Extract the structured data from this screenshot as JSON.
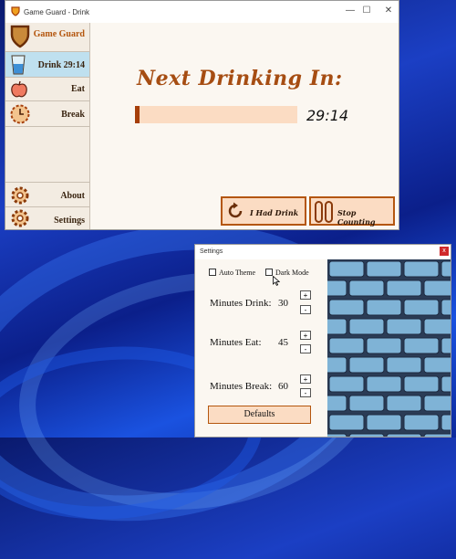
{
  "window": {
    "title": "Game Guard - Drink",
    "min_glyph": "—",
    "max_glyph": "☐",
    "close_glyph": "✕"
  },
  "sidebar": {
    "brand": "Game Guard",
    "items": [
      {
        "label": "Drink 29:14",
        "icon": "glass-icon"
      },
      {
        "label": "Eat",
        "icon": "apple-icon"
      },
      {
        "label": "Break",
        "icon": "clock-icon"
      },
      {
        "label": "About",
        "icon": "gear-icon"
      },
      {
        "label": "Settings",
        "icon": "gear-icon"
      }
    ]
  },
  "main": {
    "heading": "Next Drinking In:",
    "timer": "29:14",
    "progress_fraction": 0.03,
    "buttons": {
      "had_drink": "I Had Drink",
      "stop_counting": "Stop Counting"
    }
  },
  "settings": {
    "title": "Settings",
    "close_glyph": "x",
    "auto_theme": "Auto Theme",
    "dark_mode": "Dark Mode",
    "rows": [
      {
        "label": "Minutes Drink:",
        "value": "30"
      },
      {
        "label": "Minutes Eat:",
        "value": "45"
      },
      {
        "label": "Minutes Break:",
        "value": "60"
      }
    ],
    "plus": "+",
    "minus": "-",
    "defaults": "Defaults"
  },
  "colors": {
    "accent": "#b4560e",
    "progress_bg": "#fbdcc3",
    "progress_fill": "#a63f0a",
    "brick": "#7fb3d6"
  }
}
